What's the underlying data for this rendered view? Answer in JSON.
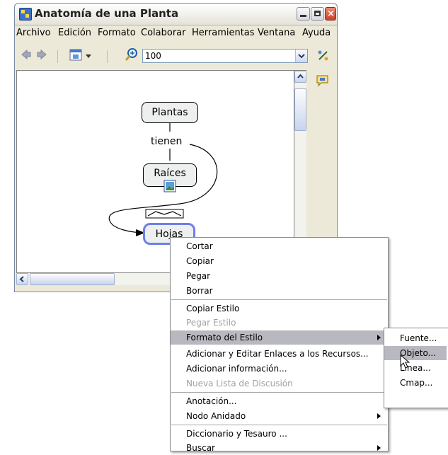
{
  "window": {
    "title": "Anatomía de una Planta"
  },
  "menubar": [
    "Archivo",
    "Edición",
    "Formato",
    "Colaborar",
    "Herramientas",
    "Ventana",
    "Ayuda"
  ],
  "toolbar": {
    "zoom_value": "100"
  },
  "concept_map": {
    "nodes": [
      "Plantas",
      "Raíces",
      "Hojas"
    ],
    "linking_phrase": "tienen"
  },
  "context_menu": {
    "items": [
      {
        "label": "Cortar",
        "enabled": true
      },
      {
        "label": "Copiar",
        "enabled": true
      },
      {
        "label": "Pegar",
        "enabled": true
      },
      {
        "label": "Borrar",
        "enabled": true
      },
      {
        "label": "Copiar Estilo",
        "enabled": true
      },
      {
        "label": "Pegar Estilo",
        "enabled": false
      },
      {
        "label": "Formato del Estilo",
        "enabled": true,
        "submenu": true,
        "highlighted": true
      },
      {
        "label": "Adicionar y Editar Enlaces a los Recursos...",
        "enabled": true
      },
      {
        "label": "Adicionar información...",
        "enabled": true
      },
      {
        "label": "Nueva Lista de Discusión",
        "enabled": false
      },
      {
        "label": "Anotación...",
        "enabled": true
      },
      {
        "label": "Nodo Anidado",
        "enabled": true,
        "submenu": true
      },
      {
        "label": "Diccionario y Tesauro ...",
        "enabled": true
      },
      {
        "label": "Buscar",
        "enabled": true,
        "submenu": true
      }
    ]
  },
  "submenu": {
    "items": [
      "Fuente...",
      "Objeto...",
      "Línea...",
      "Cmap..."
    ],
    "highlighted": "Objeto..."
  },
  "colors": {
    "selection_border": "#6f7fe8",
    "node_fill": "#eef0f0",
    "menu_highlight": "#b8b8c0"
  }
}
